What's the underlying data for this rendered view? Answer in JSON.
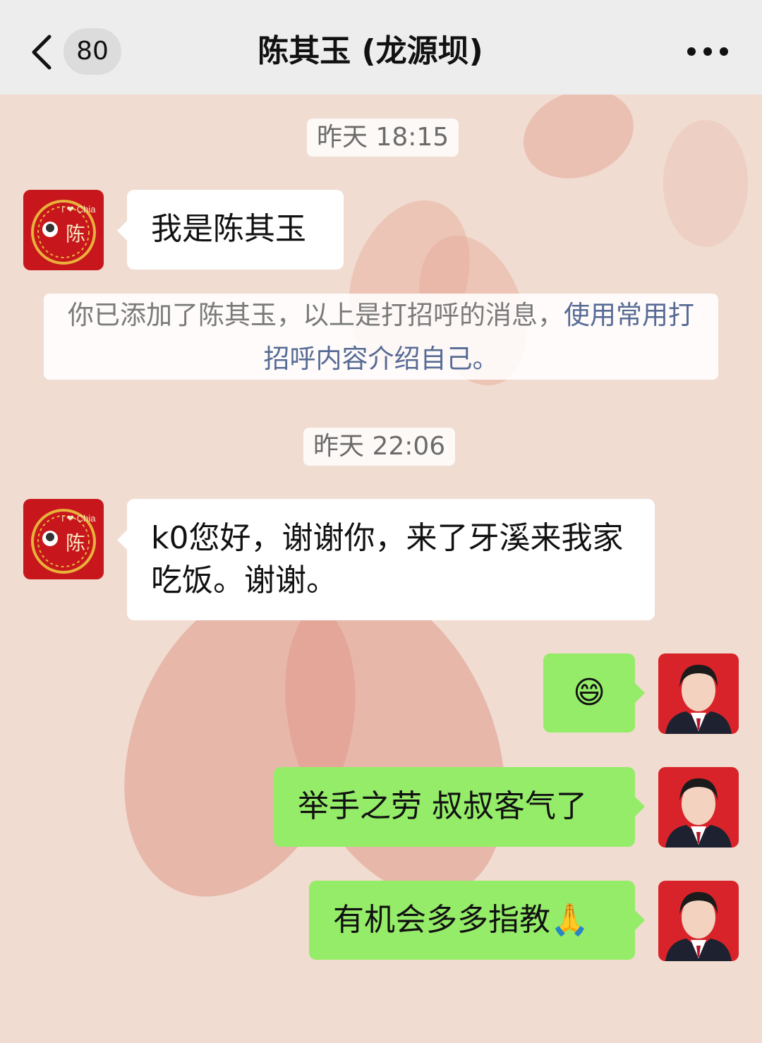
{
  "header": {
    "unread_count": "80",
    "title": "陈其玉 (龙源坝)"
  },
  "messages": {
    "time1": "昨天 18:15",
    "msg1": "我是陈其玉",
    "system_note_text": "你已添加了陈其玉，以上是打招呼的消息，",
    "system_note_link": "使用常用打招呼内容介绍自己。",
    "time2": "昨天 22:06",
    "msg2": "k0您好，谢谢你，来了牙溪来我家吃饭。谢谢。",
    "out1_emoji": "😄",
    "out2": "举手之劳 叔叔客气了",
    "out3": "有机会多多指教",
    "out3_emoji": "🙏"
  },
  "avatars": {
    "contact_badge_text": "I ❤ Chia",
    "contact_badge_char": "陈"
  },
  "colors": {
    "header_bg": "#ededed",
    "outgoing_bubble": "#95ec69",
    "incoming_bubble": "#ffffff",
    "link": "#576b95",
    "avatar_red": "#c8161d"
  },
  "icons": {
    "back": "chevron-left-icon",
    "more": "more-dots-icon"
  }
}
